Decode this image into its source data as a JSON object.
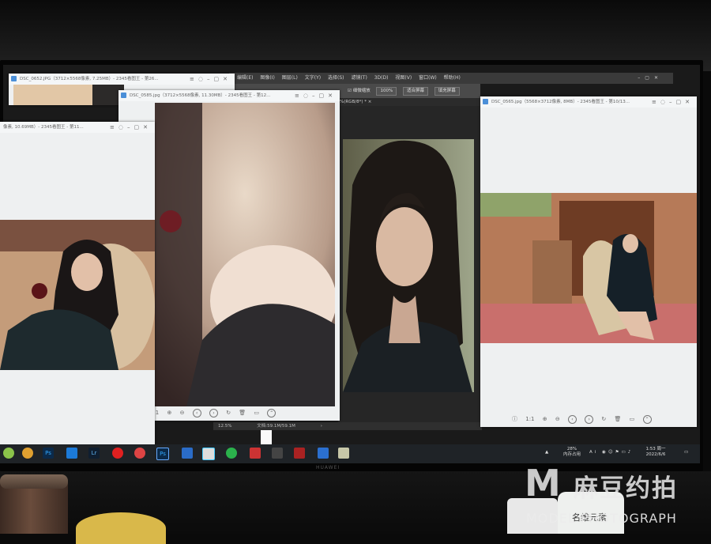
{
  "photoshop": {
    "menu": [
      "编辑(E)",
      "图像(I)",
      "图层(L)",
      "文字(Y)",
      "选择(S)",
      "滤镜(T)",
      "3D(D)",
      "视图(V)",
      "窗口(W)",
      "帮助(H)"
    ],
    "option_checkbox_label": "细微缩放",
    "zoom_value": "100%",
    "fit_screen_label": "适合屏幕",
    "fill_screen_label": "填充屏幕",
    "doc_tab": "%(RGB/8*) *",
    "status_zoom": "12.5%",
    "status_doc": "文档:59.1M/59.1M"
  },
  "windows": [
    {
      "title": "DSC_0652.JPG（3712×5568像素, 7.25MB）- 2345看图王 - 第26..."
    },
    {
      "title": "DSC_0585.jpg（3712×5568像素, 11.30MB）- 2345看图王 - 第12..."
    },
    {
      "title": "像素, 10.69MB）- 2345看图王 - 第11..."
    },
    {
      "title": "DSC_0565.jpg（5568×3712像素, 8MB）- 2345看图王 - 第10/13..."
    }
  ],
  "taskbar": {
    "cpu_percent": "28%",
    "cpu_label": "内存占用",
    "time": "1:53 周一",
    "date": "2022/6/6",
    "ai_label": "Ai",
    "lr_label": "Lr",
    "ps_label": "Ps"
  },
  "desk": {
    "bottle_label": "名维元素"
  },
  "watermark": {
    "letter": "M",
    "chinese": "麻豆约拍",
    "english": "MODEL PHOTOGRAPH"
  },
  "monitor_brand": "HUAWEI"
}
